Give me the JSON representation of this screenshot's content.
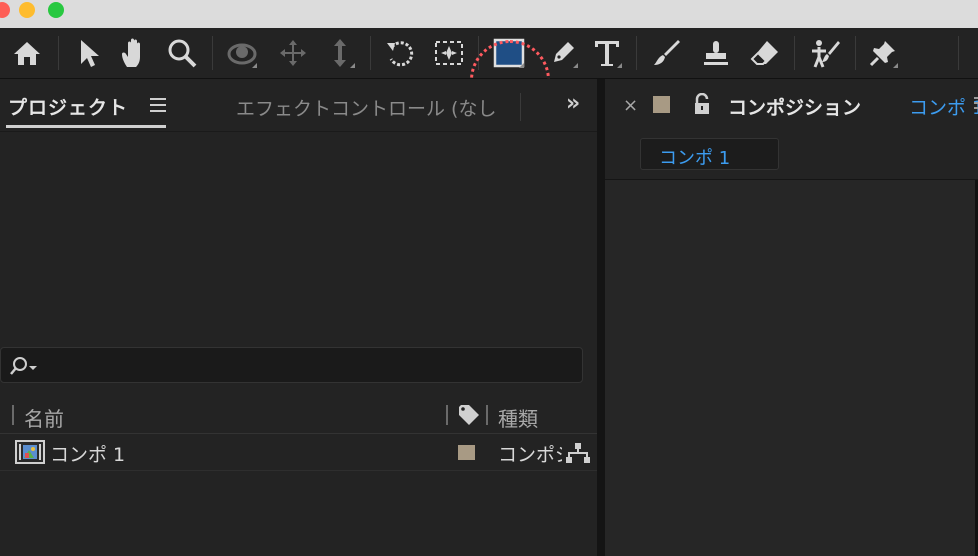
{
  "toolbar": {
    "tools": [
      {
        "name": "home-icon"
      },
      {
        "name": "selection-arrow-icon"
      },
      {
        "name": "hand-icon"
      },
      {
        "name": "zoom-icon"
      },
      {
        "name": "orbit-camera-icon"
      },
      {
        "name": "pan-camera-icon"
      },
      {
        "name": "dolly-camera-icon"
      },
      {
        "name": "rotation-icon"
      },
      {
        "name": "anchor-point-icon"
      },
      {
        "name": "rectangle-shape-icon",
        "selected": true
      },
      {
        "name": "pen-icon"
      },
      {
        "name": "text-icon",
        "label": "T"
      },
      {
        "name": "brush-icon"
      },
      {
        "name": "clone-stamp-icon"
      },
      {
        "name": "eraser-icon"
      },
      {
        "name": "puppet-icon"
      },
      {
        "name": "pin-icon"
      }
    ],
    "accent_color": "#1f4e85"
  },
  "project_panel": {
    "tab_label": "プロジェクト",
    "menu_icon": "hamburger-icon",
    "effect_tab_label": "エフェクトコントロール (なし",
    "overflow_icon": "double-chevron-icon",
    "columns": {
      "name": "名前",
      "tag_icon": "label-tag-icon",
      "type": "種類"
    },
    "items": [
      {
        "name": "コンポ 1",
        "type": "コンポジション",
        "label_color": "#a89a84",
        "icon": "composition-icon"
      }
    ]
  },
  "comp_panel": {
    "close_label": "×",
    "title": "コンポジション",
    "comp_name": "コンポ 1",
    "tab_label": "コンポ 1",
    "label_color": "#a89a84",
    "link_color": "#3c9cf0"
  }
}
